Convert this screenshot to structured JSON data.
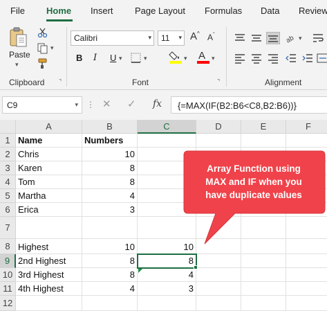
{
  "menu": {
    "tabs": [
      "File",
      "Home",
      "Insert",
      "Page Layout",
      "Formulas",
      "Data",
      "Review"
    ],
    "active": "Home"
  },
  "ribbon": {
    "clipboard": {
      "paste_label": "Paste",
      "group_label": "Clipboard"
    },
    "font": {
      "font_name": "Calibri",
      "font_size": "11",
      "bold": "B",
      "italic": "I",
      "underline": "U",
      "group_label": "Font"
    },
    "alignment": {
      "group_label": "Alignment"
    },
    "colors": {
      "highlight": "#ffff00",
      "font_color": "#ff0000",
      "accent": "#1e6e42"
    }
  },
  "formula_bar": {
    "name_box": "C9",
    "fx_label": "fx",
    "formula": "{=MAX(IF(B2:B6<C8,B2:B6))}"
  },
  "grid": {
    "columns": [
      "A",
      "B",
      "C",
      "D",
      "E",
      "F"
    ],
    "rows": [
      "1",
      "2",
      "3",
      "4",
      "5",
      "6",
      "7",
      "8",
      "9",
      "10",
      "11",
      "12"
    ],
    "selected_cell": "C9",
    "cells": {
      "A1": "Name",
      "B1": "Numbers",
      "A2": "Chris",
      "B2": "10",
      "A3": "Karen",
      "B3": "8",
      "A4": "Tom",
      "B4": "8",
      "A5": "Martha",
      "B5": "4",
      "A6": "Erica",
      "B6": "3",
      "A8": "Highest",
      "B8": "10",
      "C8": "10",
      "A9": "2nd Highest",
      "B9": "8",
      "C9": "8",
      "A10": "3rd Highest",
      "B10": "8",
      "C10": "4",
      "A11": "4th Highest",
      "B11": "4",
      "C11": "3"
    }
  },
  "callout": {
    "text_line1": "Array Function using",
    "text_line2": "MAX and IF when you",
    "text_line3": "have duplicate values",
    "color": "#f0424a"
  }
}
